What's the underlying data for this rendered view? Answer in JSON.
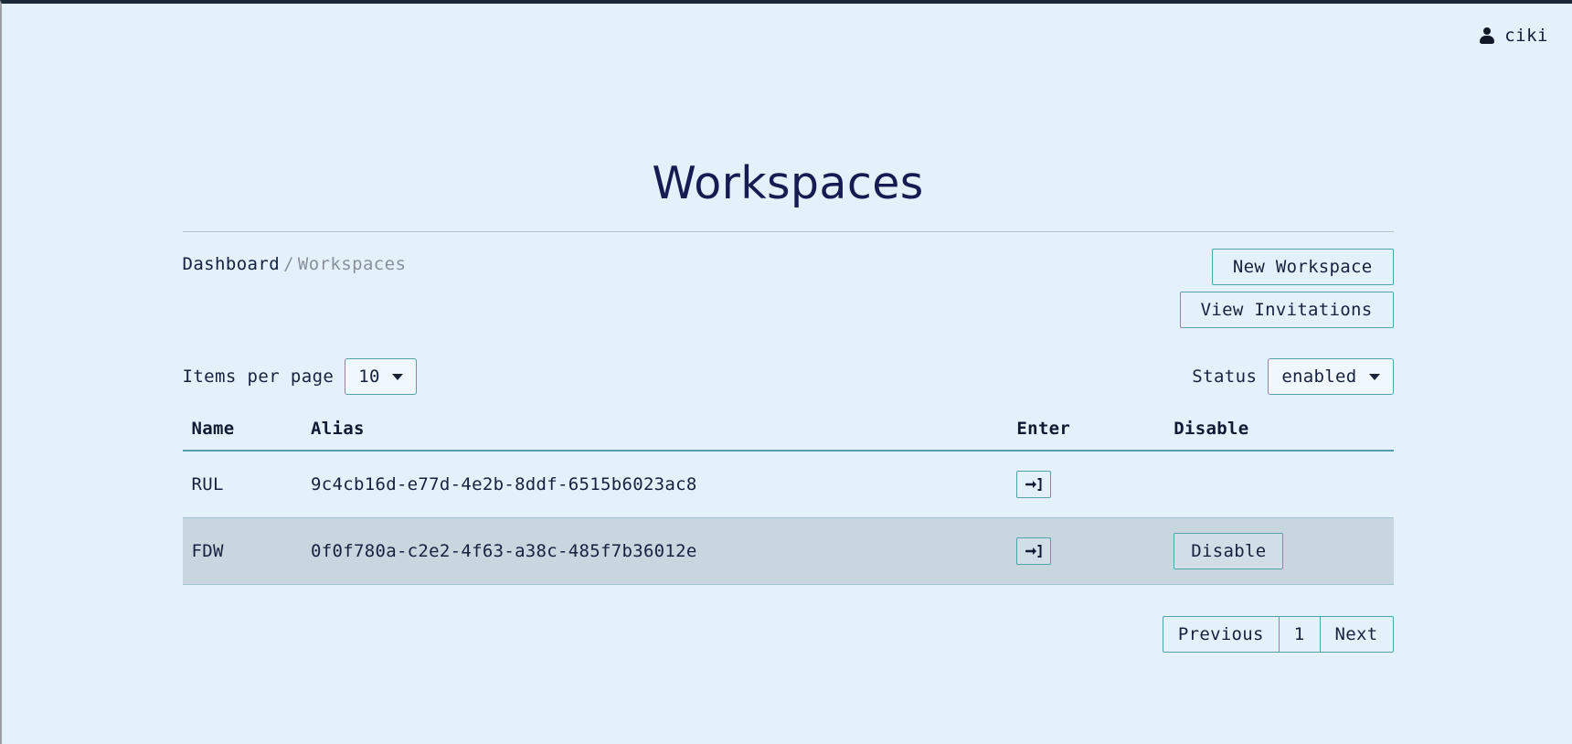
{
  "topbar": {
    "user_icon": "person-icon",
    "username": "ciki"
  },
  "page": {
    "title": "Workspaces"
  },
  "breadcrumb": {
    "root_label": "Dashboard",
    "separator": "/",
    "current_label": "Workspaces"
  },
  "actions": {
    "new_workspace_label": "New Workspace",
    "view_invitations_label": "View Invitations"
  },
  "controls": {
    "items_per_page_label": "Items per page",
    "items_per_page_value": "10",
    "items_per_page_options": [
      "10"
    ],
    "status_label": "Status",
    "status_value": "enabled",
    "status_options": [
      "enabled"
    ]
  },
  "table": {
    "columns": [
      "Name",
      "Alias",
      "Enter",
      "Disable"
    ],
    "rows": [
      {
        "name": "RUL",
        "alias": "9c4cb16d-e77d-4e2b-8ddf-6515b6023ac8",
        "enter_icon": "sign-in-icon",
        "disable_label": "",
        "has_disable": false,
        "highlighted": false
      },
      {
        "name": "FDW",
        "alias": "0f0f780a-c2e2-4f63-a38c-485f7b36012e",
        "enter_icon": "sign-in-icon",
        "disable_label": "Disable",
        "has_disable": true,
        "highlighted": true
      }
    ]
  },
  "pagination": {
    "previous_label": "Previous",
    "page_label": "1",
    "next_label": "Next"
  },
  "colors": {
    "background": "#e4f1fb",
    "accent_border": "#53a3ab",
    "text": "#16213d",
    "title": "#141c52",
    "muted": "#8a9099",
    "row_highlight": "#c8d6e0"
  }
}
